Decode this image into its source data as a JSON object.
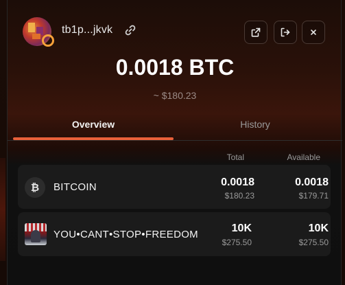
{
  "wallet": {
    "address": "tb1p...jkvk",
    "balance": "0.0018 BTC",
    "balance_usd": "~ $180.23"
  },
  "header": {
    "actions": [
      {
        "icon": "external-link-icon"
      },
      {
        "icon": "logout-icon"
      },
      {
        "icon": "close-icon"
      }
    ]
  },
  "tabs": [
    {
      "label": "Overview",
      "active": true
    },
    {
      "label": "History",
      "active": false
    }
  ],
  "columns": {
    "total": "Total",
    "available": "Available"
  },
  "assets": [
    {
      "icon_glyph": "₿",
      "name": "BITCOIN",
      "total": "0.0018",
      "total_usd": "$180.23",
      "available": "0.0018",
      "available_usd": "$179.71"
    },
    {
      "name": "YOU•CANT•STOP•FREEDOM",
      "total": "10K",
      "total_usd": "$275.50",
      "available": "10K",
      "available_usd": "$275.50"
    }
  ],
  "colors": {
    "accent": "#e8603a",
    "row_bg": "#1b1b1b",
    "muted_text": "#9a9a9a"
  }
}
